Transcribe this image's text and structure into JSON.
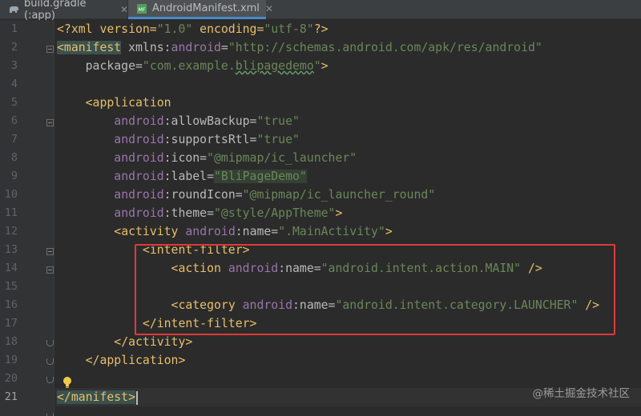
{
  "tabs": [
    {
      "label": "build.gradle (:app)",
      "icon": "gradle-elephant-icon",
      "close": "✕"
    },
    {
      "label": "AndroidManifest.xml",
      "icon": "manifest-file-icon",
      "icon_text": "MF",
      "close": "✕",
      "active": true
    }
  ],
  "line_numbers": [
    "1",
    "2",
    "3",
    "4",
    "5",
    "6",
    "7",
    "8",
    "9",
    "10",
    "11",
    "12",
    "13",
    "14",
    "15",
    "16",
    "17",
    "18",
    "19",
    "20",
    "21"
  ],
  "current_line": 21,
  "code": {
    "l1": {
      "decl": "<?xml version=",
      "v1": "\"1.0\"",
      "mid": " encoding=",
      "v2": "\"utf-8\"",
      "end": "?>"
    },
    "l2": {
      "open": "<manifest",
      "attr": " xmlns:",
      "ns": "android",
      "eq": "=",
      "val": "\"http://schemas.android.com/apk/res/android\""
    },
    "l3": {
      "attr": "package=",
      "q1": "\"com.example.",
      "typo": "blipagedemo",
      "q2": "\"",
      "close": ">"
    },
    "l5": {
      "open": "<application"
    },
    "l6": {
      "ns": "android",
      "attr": ":allowBackup=",
      "val": "\"true\""
    },
    "l7": {
      "ns": "android",
      "attr": ":supportsRtl=",
      "val": "\"true\""
    },
    "l8": {
      "ns": "android",
      "attr": ":icon=",
      "val": "\"@mipmap/ic_launcher\""
    },
    "l9": {
      "ns": "android",
      "attr": ":label=",
      "val": "\"BliPageDemo\""
    },
    "l10": {
      "ns": "android",
      "attr": ":roundIcon=",
      "val": "\"@mipmap/ic_launcher_round\""
    },
    "l11": {
      "ns": "android",
      "attr": ":theme=",
      "val": "\"@style/AppTheme\"",
      "close": ">"
    },
    "l12": {
      "open": "<activity",
      "ns": " android",
      "attr": ":name=",
      "val": "\".MainActivity\"",
      "close": ">"
    },
    "l13": {
      "open": "<intent-filter>"
    },
    "l14": {
      "open": "<action",
      "ns": " android",
      "attr": ":name=",
      "val": "\"android.intent.action.MAIN\"",
      "close": " />"
    },
    "l16": {
      "open": "<category",
      "ns": " android",
      "attr": ":name=",
      "val": "\"android.intent.category.LAUNCHER\"",
      "close": " />"
    },
    "l17": {
      "close": "</intent-filter>"
    },
    "l18": {
      "close": "</activity>"
    },
    "l19": {
      "close": "</application>"
    },
    "l21": {
      "close": "</manifest>"
    }
  },
  "colors": {
    "tag": "#e8bf6a",
    "namespace": "#9876aa",
    "string": "#6a8759",
    "attribute": "#bababa",
    "highlight_box": "#e03a3a",
    "active_tab_underline": "#4a88c7"
  },
  "watermark": "@稀土掘金技术社区"
}
